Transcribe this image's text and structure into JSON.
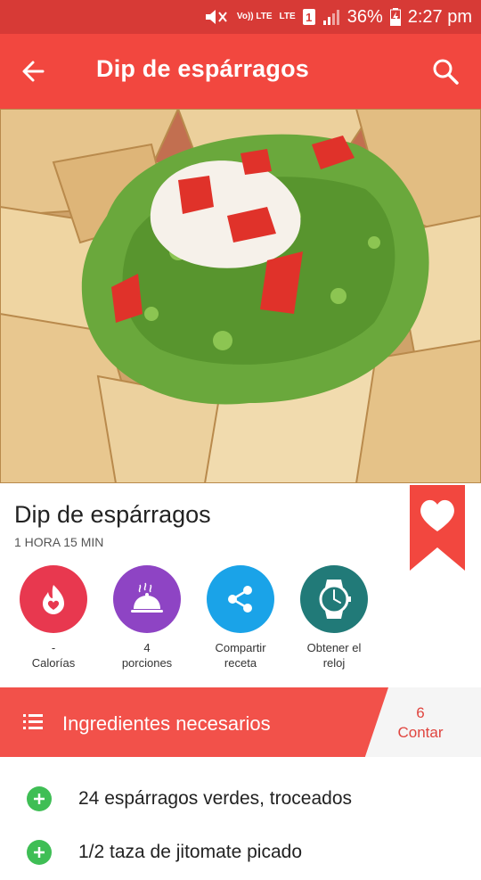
{
  "status_bar": {
    "volte": "Vo)) LTE",
    "lte": "LTE",
    "sim": "1",
    "battery": "36%",
    "time": "2:27 pm"
  },
  "app_bar": {
    "title": "Dip de espárragos",
    "back_icon": "arrow-left-icon",
    "search_icon": "search-icon"
  },
  "recipe": {
    "title": "Dip de espárragos",
    "time": "1 HORA 15 MIN",
    "favorite_icon": "heart-icon"
  },
  "actions": [
    {
      "value": "-",
      "label": "Calorías",
      "icon": "flame-heart-icon",
      "color": "#e8384f"
    },
    {
      "value": "4",
      "label": "porciones",
      "icon": "cloche-icon",
      "color": "#8e44c4"
    },
    {
      "value": "Compartir",
      "label": "receta",
      "icon": "share-icon",
      "color": "#1aa3e8"
    },
    {
      "value": "Obtener el",
      "label": "reloj",
      "icon": "watch-icon",
      "color": "#217a78"
    }
  ],
  "ingredients": {
    "title": "Ingredientes necesarios",
    "count": "6",
    "count_label": "Contar",
    "items": [
      "24 espárragos verdes, troceados",
      "1/2 taza de jitomate picado"
    ]
  },
  "colors": {
    "status_bar": "#d73a36",
    "app_bar": "#f2473f",
    "band": "#f2514a",
    "add": "#3fbe55"
  }
}
